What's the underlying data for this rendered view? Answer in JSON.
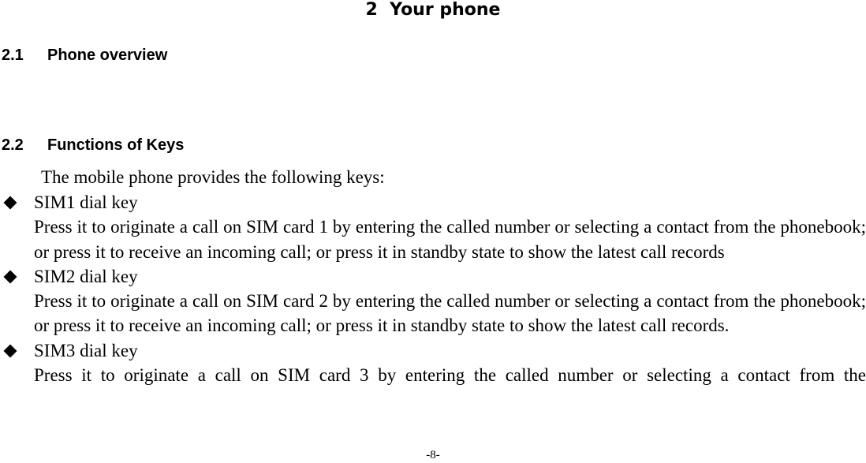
{
  "chapter": {
    "title": "2  Your phone"
  },
  "sections": [
    {
      "number": "2.1",
      "title": "Phone overview"
    },
    {
      "number": "2.2",
      "title": "Functions of Keys"
    }
  ],
  "intro": "The mobile phone provides the following keys:",
  "keys": [
    {
      "title": "SIM1 dial key",
      "description": "Press it to originate a call on SIM card 1 by entering the called number or selecting a contact from the phonebook; or press it to receive an incoming call; or press it in standby state to show the latest call records"
    },
    {
      "title": "SIM2 dial key",
      "description": "Press it to originate a call on SIM card 2 by entering the called number or selecting a contact from the phonebook; or press it to receive an incoming call; or press it in standby state to show the latest call records."
    },
    {
      "title": "SIM3 dial key",
      "description": "Press it to originate a call on SIM card 3 by entering the called number or selecting a contact from the"
    }
  ],
  "footer": {
    "page_number": "-8-"
  },
  "icons": {
    "bullet": "black-diamond"
  }
}
